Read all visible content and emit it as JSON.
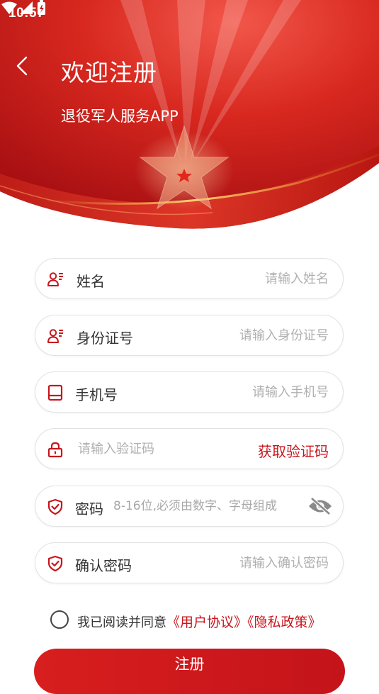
{
  "status_bar": {
    "time": "10:57"
  },
  "header": {
    "title": "欢迎注册",
    "subtitle": "退役军人服务APP"
  },
  "colors": {
    "brand_red": "#c8161d",
    "banner_red": "#d42a22"
  },
  "form": {
    "name": {
      "label": "姓名",
      "placeholder": "请输入姓名",
      "icon": "person-card-icon"
    },
    "id_number": {
      "label": "身份证号",
      "placeholder": "请输入身份证号",
      "icon": "person-card-icon"
    },
    "phone": {
      "label": "手机号",
      "placeholder": "请输入手机号",
      "icon": "phone-icon"
    },
    "verify_code": {
      "placeholder": "请输入验证码",
      "get_code_label": "获取验证码",
      "icon": "lock-icon"
    },
    "password": {
      "label": "密码",
      "placeholder": "8-16位,必须由数字、字母组成",
      "icon": "shield-check-icon"
    },
    "confirm_password": {
      "label": "确认密码",
      "placeholder": "请输入确认密码",
      "icon": "shield-check-icon"
    }
  },
  "agreement": {
    "prefix": "我已阅读并同意",
    "user_agreement": "《用户协议》",
    "privacy_policy": "《隐私政策》"
  },
  "submit": {
    "label": "注册"
  }
}
